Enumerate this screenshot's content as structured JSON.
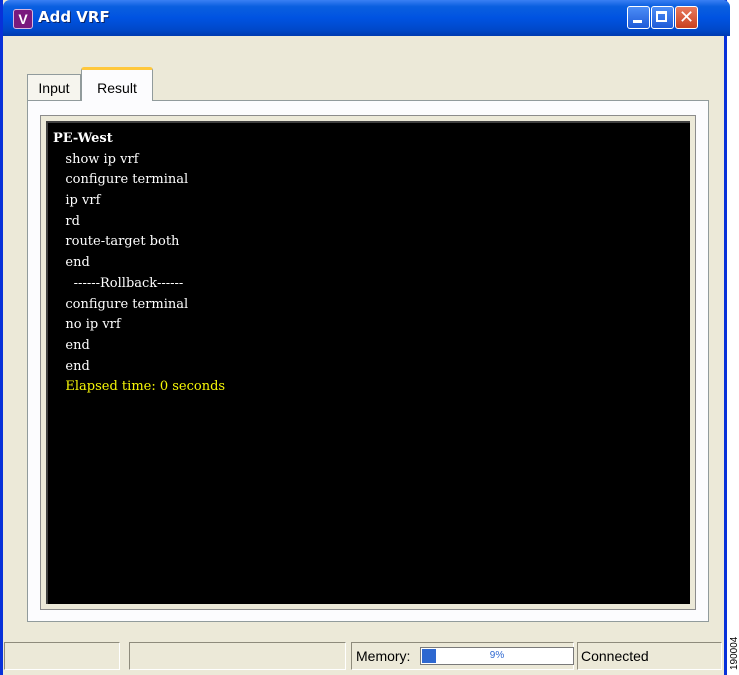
{
  "window": {
    "title": "Add VRF",
    "app_icon_letter": "V"
  },
  "titlebar_buttons": {
    "close_glyph": "✕"
  },
  "tabs": [
    {
      "label": "Input",
      "selected": false
    },
    {
      "label": "Result",
      "selected": true
    }
  ],
  "console": {
    "background": "#000000",
    "text_color": "#ffffff",
    "highlight_color": "#f7f707",
    "lines": [
      "PE-West",
      "   show ip vrf",
      "   configure terminal",
      "   ip vrf",
      "   rd",
      "   route-target both",
      "   end",
      "     ------Rollback------",
      "   configure terminal",
      "   no ip vrf",
      "   end",
      "   end",
      "   Elapsed time: 0 seconds"
    ]
  },
  "status_bar": {
    "memory_label": "Memory:",
    "memory_percent_text": "9%",
    "memory_fraction": 0.09,
    "connection_status": "Connected"
  },
  "side_id": "190004"
}
